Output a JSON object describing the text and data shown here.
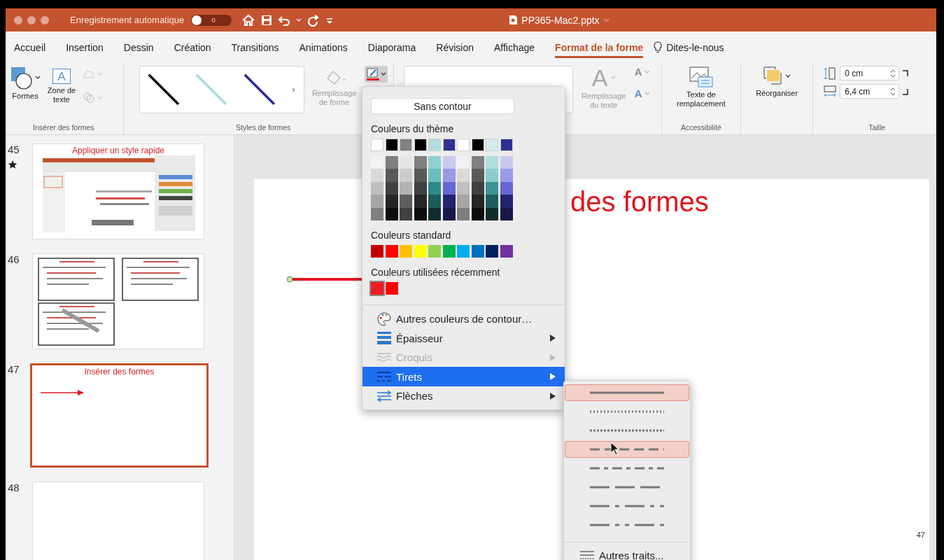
{
  "window": {
    "autosave_label": "Enregistrement automatique",
    "autosave": {
      "on": false,
      "text": "o"
    },
    "title": "PP365-Mac2.pptx"
  },
  "tabs": [
    {
      "label": "Accueil",
      "selected": false
    },
    {
      "label": "Insertion",
      "selected": false
    },
    {
      "label": "Dessin",
      "selected": false
    },
    {
      "label": "Création",
      "selected": false
    },
    {
      "label": "Transitions",
      "selected": false
    },
    {
      "label": "Animations",
      "selected": false
    },
    {
      "label": "Diaporama",
      "selected": false
    },
    {
      "label": "Révision",
      "selected": false
    },
    {
      "label": "Affichage",
      "selected": false
    },
    {
      "label": "Format de la forme",
      "selected": true
    }
  ],
  "tell_me": "Dites-le-nous",
  "ribbon": {
    "groups": [
      {
        "kind": "insert",
        "label": "Insérer des formes",
        "buttons": [
          {
            "text": "Formes"
          },
          {
            "text": "Zone de texte",
            "glyph": "A"
          }
        ]
      },
      {
        "kind": "styles",
        "label": "Styles de formes",
        "styles": [
          {
            "color": "#111111"
          },
          {
            "color": "#a8dce0"
          },
          {
            "color": "#2e3192"
          }
        ],
        "more_arrow": "›",
        "fill_button": {
          "text": "Remplissage de forme",
          "disabled": true
        },
        "outline_button": {
          "pressed": true
        }
      },
      {
        "kind": "wordart",
        "text_fill_button": {
          "text": "Remplissage du texte",
          "glyph": "A",
          "disabled": true
        },
        "outline_glyph": "A",
        "effects_glyph": "A"
      },
      {
        "kind": "alt_text",
        "label": "Accessibilité",
        "button": {
          "text": "Texte de remplacement"
        }
      },
      {
        "kind": "arrange",
        "button": {
          "text": "Réorganiser"
        }
      },
      {
        "kind": "size",
        "label": "Taille",
        "fields": [
          {
            "value": "0 cm"
          },
          {
            "value": "6,4 cm"
          }
        ]
      }
    ]
  },
  "slides": [
    {
      "number": "45",
      "kind": "screenshot",
      "title": "Appliquer un style rapide",
      "animated": true,
      "selected": false
    },
    {
      "number": "46",
      "kind": "grid",
      "animated": false,
      "selected": false
    },
    {
      "number": "47",
      "kind": "arrow",
      "title": "Insérer des formes",
      "animated": false,
      "selected": true
    },
    {
      "number": "48",
      "kind": "blank",
      "animated": false,
      "selected": false
    }
  ],
  "slide": {
    "title": "des formes",
    "page_number": "47"
  },
  "outline_menu": {
    "no_outline": "Sans contour",
    "theme_label": "Couleurs du thème",
    "theme_colors": [
      {
        "color": "#ffffff",
        "shades": [
          {
            "color": "#f2f2f2"
          },
          {
            "color": "#d9d9d9"
          },
          {
            "color": "#bfbfbf"
          },
          {
            "color": "#a6a6a6"
          },
          {
            "color": "#808080"
          }
        ]
      },
      {
        "color": "#000000",
        "shades": [
          {
            "color": "#7f7f7f"
          },
          {
            "color": "#595959"
          },
          {
            "color": "#404040"
          },
          {
            "color": "#262626"
          },
          {
            "color": "#0d0d0d"
          }
        ]
      },
      {
        "color": "#808080",
        "shades": [
          {
            "color": "#e6e6e6"
          },
          {
            "color": "#cccccc"
          },
          {
            "color": "#b3b3b3"
          },
          {
            "color": "#5e5e5e"
          },
          {
            "color": "#404040"
          }
        ]
      },
      {
        "color": "#000000",
        "shades": [
          {
            "color": "#808080"
          },
          {
            "color": "#595959"
          },
          {
            "color": "#404040"
          },
          {
            "color": "#262626"
          },
          {
            "color": "#0d0d0d"
          }
        ]
      },
      {
        "color": "#b4dde0",
        "shades": [
          {
            "color": "#8fcfcf"
          },
          {
            "color": "#6bbcbc"
          },
          {
            "color": "#2e8a8a"
          },
          {
            "color": "#1d5c5c"
          },
          {
            "color": "#0e2e2e"
          }
        ]
      },
      {
        "color": "#2e3192",
        "shades": [
          {
            "color": "#c9c9f0"
          },
          {
            "color": "#9999e6"
          },
          {
            "color": "#6666d4"
          },
          {
            "color": "#23236e"
          },
          {
            "color": "#171749"
          }
        ]
      },
      {
        "color": "#ffffff",
        "shades": [
          {
            "color": "#f2f2f2"
          },
          {
            "color": "#d9d9d9"
          },
          {
            "color": "#bfbfbf"
          },
          {
            "color": "#a6a6a6"
          },
          {
            "color": "#808080"
          }
        ]
      },
      {
        "color": "#000000",
        "shades": [
          {
            "color": "#808080"
          },
          {
            "color": "#595959"
          },
          {
            "color": "#404040"
          },
          {
            "color": "#262626"
          },
          {
            "color": "#0d0d0d"
          }
        ]
      },
      {
        "color": "#d2ecee",
        "shades": [
          {
            "color": "#b3dede"
          },
          {
            "color": "#8ccccc"
          },
          {
            "color": "#3a9494"
          },
          {
            "color": "#1e5e5e"
          },
          {
            "color": "#0f2f2f"
          }
        ]
      },
      {
        "color": "#2e3192",
        "shades": [
          {
            "color": "#c9c9f0"
          },
          {
            "color": "#9999e6"
          },
          {
            "color": "#6666d4"
          },
          {
            "color": "#23236e"
          },
          {
            "color": "#171749"
          }
        ]
      }
    ],
    "standard_label": "Couleurs standard",
    "standard_colors": [
      {
        "color": "#c00000"
      },
      {
        "color": "#ff0000"
      },
      {
        "color": "#ffc000"
      },
      {
        "color": "#ffff00"
      },
      {
        "color": "#92d050"
      },
      {
        "color": "#00b050"
      },
      {
        "color": "#00b0f0"
      },
      {
        "color": "#0070c0"
      },
      {
        "color": "#002060"
      },
      {
        "color": "#7030a0"
      }
    ],
    "recent_label": "Couleurs utilisées récemment",
    "recent_colors": [
      {
        "color": "#ee1c25",
        "selected": true
      },
      {
        "color": "#ff0000",
        "selected": false
      }
    ],
    "items": [
      {
        "kind": "palette",
        "label": "Autres couleurs de contour…",
        "submenu": false,
        "disabled": false,
        "selected": false
      },
      {
        "kind": "weight",
        "label": "Épaisseur",
        "submenu": true,
        "disabled": false,
        "selected": false
      },
      {
        "kind": "sketch",
        "label": "Croquis",
        "submenu": true,
        "disabled": true,
        "selected": false
      },
      {
        "kind": "dash",
        "label": "Tirets",
        "submenu": true,
        "disabled": false,
        "selected": true
      },
      {
        "kind": "arrows",
        "label": "Flèches",
        "submenu": true,
        "disabled": false,
        "selected": false
      }
    ]
  },
  "dash_menu": {
    "styles": [
      {
        "kind": "solid",
        "highlighted": true
      },
      {
        "kind": "round-dot",
        "highlighted": false
      },
      {
        "kind": "square-dot",
        "highlighted": false
      },
      {
        "kind": "dash",
        "highlighted": true
      },
      {
        "kind": "dash-dot",
        "highlighted": false
      },
      {
        "kind": "long-dash",
        "highlighted": false
      },
      {
        "kind": "long-dash-dot",
        "highlighted": false
      },
      {
        "kind": "long-dash-dot-dot",
        "highlighted": false
      }
    ],
    "more": "Autres traits..."
  }
}
